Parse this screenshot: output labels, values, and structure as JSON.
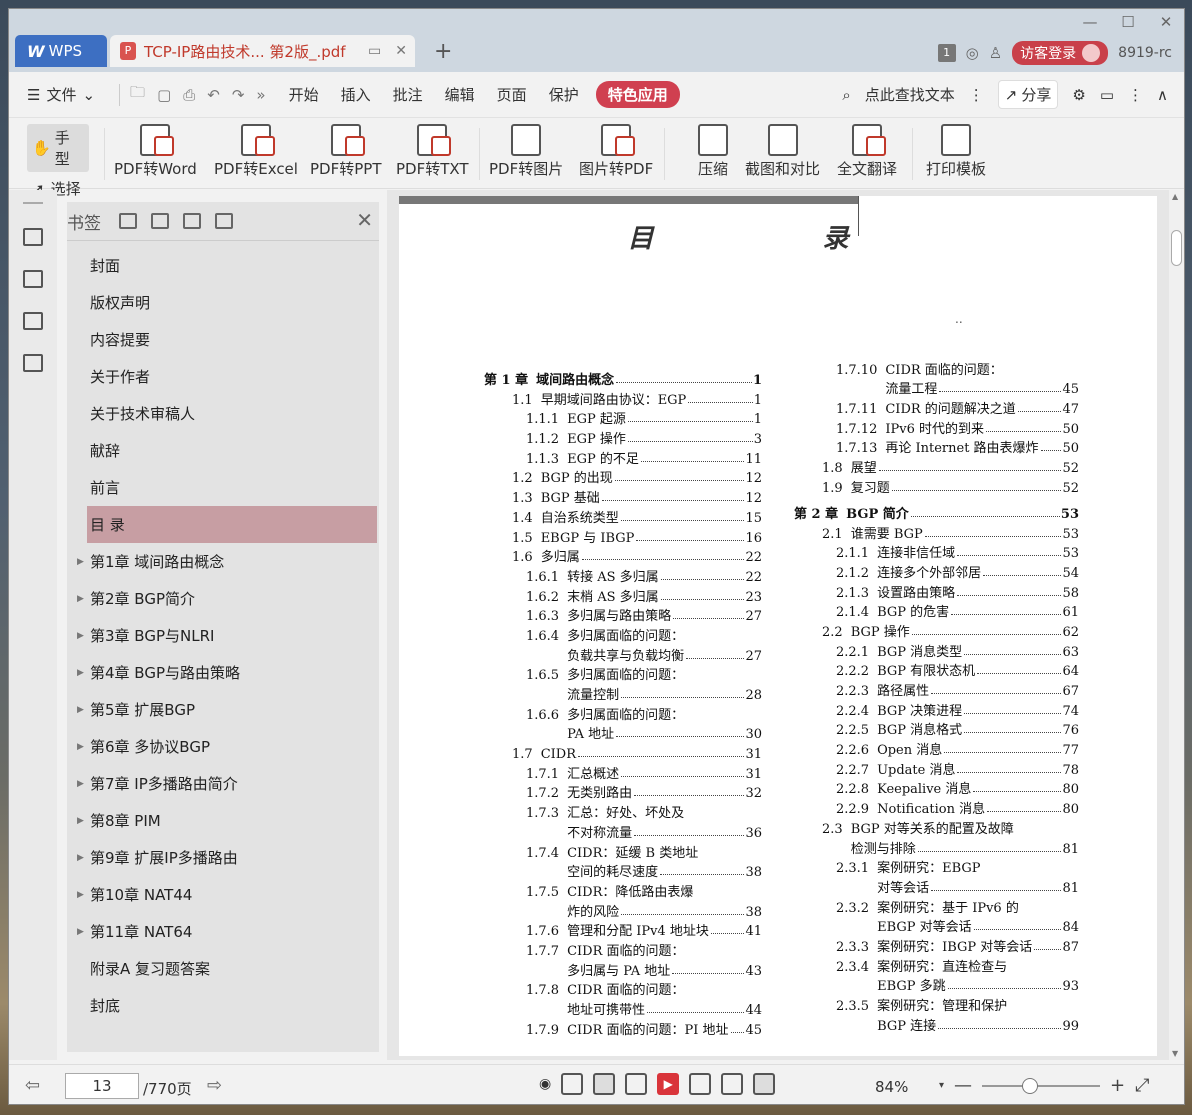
{
  "titlebar": {
    "app_tab": "WPS",
    "doc_tab": "TCP-IP路由技术... 第2版_.pdf",
    "page_badge": "1",
    "visitor_login": "访客登录",
    "user_id": "8919-rc"
  },
  "menu": {
    "file": "文件",
    "items": [
      "开始",
      "插入",
      "批注",
      "编辑",
      "页面",
      "保护"
    ],
    "special": "特色应用",
    "search": "点此查找文本",
    "share": "分享"
  },
  "toolbar": {
    "hand": "手型",
    "select": "选择",
    "tools": [
      "PDF转Word",
      "PDF转Excel",
      "PDF转PPT",
      "PDF转TXT",
      "PDF转图片",
      "图片转PDF",
      "压缩",
      "截图和对比",
      "全文翻译",
      "打印模板"
    ]
  },
  "bookmarks": {
    "title": "书签",
    "items": [
      {
        "label": "封面"
      },
      {
        "label": "版权声明"
      },
      {
        "label": "内容提要"
      },
      {
        "label": "关于作者"
      },
      {
        "label": "关于技术审稿人"
      },
      {
        "label": "献辞"
      },
      {
        "label": "前言"
      },
      {
        "label": "目  录"
      },
      {
        "label": "第1章  域间路由概念"
      },
      {
        "label": "第2章  BGP简介"
      },
      {
        "label": "第3章  BGP与NLRI"
      },
      {
        "label": "第4章  BGP与路由策略"
      },
      {
        "label": "第5章  扩展BGP"
      },
      {
        "label": "第6章  多协议BGP"
      },
      {
        "label": "第7章  IP多播路由简介"
      },
      {
        "label": "第8章  PIM"
      },
      {
        "label": "第9章  扩展IP多播路由"
      },
      {
        "label": "第10章  NAT44"
      },
      {
        "label": "第11章  NAT64"
      },
      {
        "label": "附录A  复习题答案"
      },
      {
        "label": "封底"
      }
    ]
  },
  "page": {
    "heading": "目 录",
    "dots": "..",
    "col1": [
      {
        "num": "第 1 章",
        "title": "域间路由概念",
        "page": "1"
      },
      {
        "num": "1.1",
        "title": "早期域间路由协议：EGP",
        "page": "1"
      },
      {
        "num": "1.1.1",
        "title": "EGP 起源",
        "page": "1"
      },
      {
        "num": "1.1.2",
        "title": "EGP 操作",
        "page": "3"
      },
      {
        "num": "1.1.3",
        "title": "EGP 的不足",
        "page": "11"
      },
      {
        "num": "1.2",
        "title": "BGP 的出现",
        "page": "12"
      },
      {
        "num": "1.3",
        "title": "BGP 基础",
        "page": "12"
      },
      {
        "num": "1.4",
        "title": "自治系统类型",
        "page": "15"
      },
      {
        "num": "1.5",
        "title": "EBGP 与 IBGP",
        "page": "16"
      },
      {
        "num": "1.6",
        "title": "多归属",
        "page": "22"
      },
      {
        "num": "1.6.1",
        "title": "转接 AS 多归属",
        "page": "22"
      },
      {
        "num": "1.6.2",
        "title": "末梢 AS 多归属",
        "page": "23"
      },
      {
        "num": "1.6.3",
        "title": "多归属与路由策略",
        "page": "27"
      },
      {
        "num": "1.6.4",
        "title": "多归属面临的问题：",
        "page": ""
      },
      {
        "num": "",
        "title": "负载共享与负载均衡",
        "page": "27"
      },
      {
        "num": "1.6.5",
        "title": "多归属面临的问题：",
        "page": ""
      },
      {
        "num": "",
        "title": "流量控制",
        "page": "28"
      },
      {
        "num": "1.6.6",
        "title": "多归属面临的问题：",
        "page": ""
      },
      {
        "num": "",
        "title": "PA 地址",
        "page": "30"
      },
      {
        "num": "1.7",
        "title": "CIDR",
        "page": "31"
      },
      {
        "num": "1.7.1",
        "title": "汇总概述",
        "page": "31"
      },
      {
        "num": "1.7.2",
        "title": "无类别路由",
        "page": "32"
      },
      {
        "num": "1.7.3",
        "title": "汇总：好处、坏处及",
        "page": ""
      },
      {
        "num": "",
        "title": "不对称流量",
        "page": "36"
      },
      {
        "num": "1.7.4",
        "title": "CIDR：延缓 B 类地址",
        "page": ""
      },
      {
        "num": "",
        "title": "空间的耗尽速度",
        "page": "38"
      },
      {
        "num": "1.7.5",
        "title": "CIDR：降低路由表爆",
        "page": ""
      },
      {
        "num": "",
        "title": "炸的风险",
        "page": "38"
      },
      {
        "num": "1.7.6",
        "title": "管理和分配 IPv4 地址块",
        "page": "41"
      },
      {
        "num": "1.7.7",
        "title": "CIDR 面临的问题：",
        "page": ""
      },
      {
        "num": "",
        "title": "多归属与 PA 地址",
        "page": "43"
      },
      {
        "num": "1.7.8",
        "title": "CIDR 面临的问题：",
        "page": ""
      },
      {
        "num": "",
        "title": "地址可携带性",
        "page": "44"
      },
      {
        "num": "1.7.9",
        "title": "CIDR 面临的问题：PI 地址",
        "page": "45"
      }
    ],
    "col2": [
      {
        "num": "1.7.10",
        "title": "CIDR 面临的问题：",
        "page": ""
      },
      {
        "num": "",
        "title": "流量工程",
        "page": "45"
      },
      {
        "num": "1.7.11",
        "title": "CIDR 的问题解决之道",
        "page": "47"
      },
      {
        "num": "1.7.12",
        "title": "IPv6 时代的到来",
        "page": "50"
      },
      {
        "num": "1.7.13",
        "title": "再论 Internet 路由表爆炸",
        "page": "50"
      },
      {
        "num": "1.8",
        "title": "展望",
        "page": "52"
      },
      {
        "num": "1.9",
        "title": "复习题",
        "page": "52"
      },
      {
        "num": "第 2 章",
        "title": "BGP 简介",
        "page": "53"
      },
      {
        "num": "2.1",
        "title": "谁需要 BGP",
        "page": "53"
      },
      {
        "num": "2.1.1",
        "title": "连接非信任域",
        "page": "53"
      },
      {
        "num": "2.1.2",
        "title": "连接多个外部邻居",
        "page": "54"
      },
      {
        "num": "2.1.3",
        "title": "设置路由策略",
        "page": "58"
      },
      {
        "num": "2.1.4",
        "title": "BGP 的危害",
        "page": "61"
      },
      {
        "num": "2.2",
        "title": "BGP 操作",
        "page": "62"
      },
      {
        "num": "2.2.1",
        "title": "BGP 消息类型",
        "page": "63"
      },
      {
        "num": "2.2.2",
        "title": "BGP 有限状态机",
        "page": "64"
      },
      {
        "num": "2.2.3",
        "title": "路径属性",
        "page": "67"
      },
      {
        "num": "2.2.4",
        "title": "BGP 决策进程",
        "page": "74"
      },
      {
        "num": "2.2.5",
        "title": "BGP 消息格式",
        "page": "76"
      },
      {
        "num": "2.2.6",
        "title": "Open 消息",
        "page": "77"
      },
      {
        "num": "2.2.7",
        "title": "Update 消息",
        "page": "78"
      },
      {
        "num": "2.2.8",
        "title": "Keepalive 消息",
        "page": "80"
      },
      {
        "num": "2.2.9",
        "title": "Notification 消息",
        "page": "80"
      },
      {
        "num": "2.3",
        "title": "BGP 对等关系的配置及故障",
        "page": ""
      },
      {
        "num": "",
        "title": "检测与排除",
        "page": "81"
      },
      {
        "num": "2.3.1",
        "title": "案例研究：EBGP",
        "page": ""
      },
      {
        "num": "",
        "title": "对等会话",
        "page": "81"
      },
      {
        "num": "2.3.2",
        "title": "案例研究：基于 IPv6 的",
        "page": ""
      },
      {
        "num": "",
        "title": "EBGP 对等会话",
        "page": "84"
      },
      {
        "num": "2.3.3",
        "title": "案例研究：IBGP 对等会话",
        "page": "87"
      },
      {
        "num": "2.3.4",
        "title": "案例研究：直连检查与",
        "page": ""
      },
      {
        "num": "",
        "title": "EBGP 多跳",
        "page": "93"
      },
      {
        "num": "2.3.5",
        "title": "案例研究：管理和保护",
        "page": ""
      },
      {
        "num": "",
        "title": "BGP 连接",
        "page": "99"
      }
    ]
  },
  "status": {
    "current_page": "13",
    "total_pages": "/770页",
    "zoom": "84%"
  }
}
